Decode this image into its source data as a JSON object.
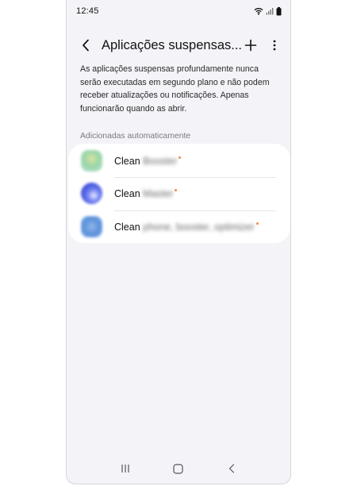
{
  "status_bar": {
    "time": "12:45",
    "icons": [
      "wifi-icon",
      "signal-icon",
      "battery-icon"
    ]
  },
  "header": {
    "title": "Aplicações suspensas...",
    "back_icon": "back-arrow-icon",
    "add_icon": "plus-icon",
    "more_icon": "more-vertical-icon"
  },
  "description": "As aplicações suspensas profundamente nunca serão executadas em segundo plano e não podem receber atualizações ou notificações. Apenas funcionarão quando as abrir.",
  "section": {
    "title": "Adicionadas automaticamente"
  },
  "apps": [
    {
      "name": "Clean",
      "hidden_suffix": "Booster"
    },
    {
      "name": "Clean",
      "hidden_suffix": "Master"
    },
    {
      "name": "Clean",
      "hidden_suffix": "phone, booster, optimizer"
    }
  ],
  "nav_bar": {
    "icons": [
      "recents-icon",
      "home-icon",
      "back-icon"
    ]
  },
  "colors": {
    "background": "#f4f3f8",
    "card": "#ffffff",
    "badge_dot": "#f08a4b"
  }
}
